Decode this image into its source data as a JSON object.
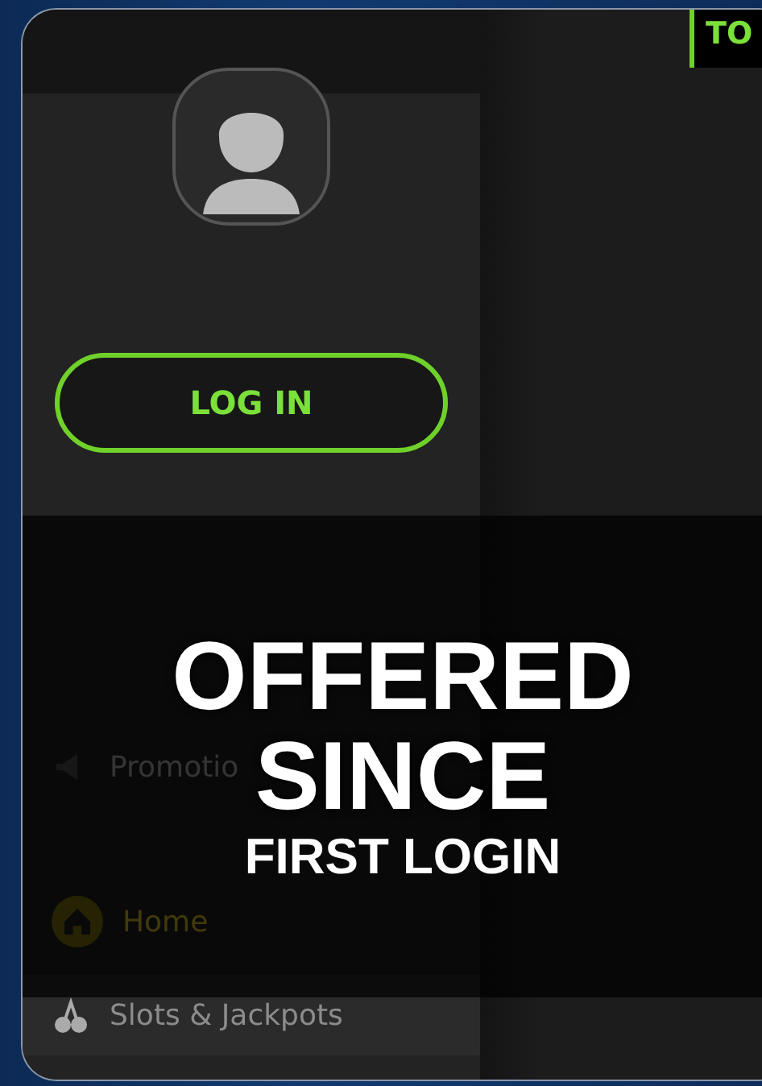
{
  "header_tab": {
    "label": "TO"
  },
  "login_button": {
    "label": "LOG IN"
  },
  "menu": [
    {
      "label": "Promotio",
      "kind": "promotions"
    },
    {
      "label": "Home",
      "kind": "home"
    },
    {
      "label": "Slots & Jackpots",
      "kind": "slots"
    }
  ],
  "banner": {
    "lines": [
      {
        "text": "OFFERED",
        "kind": "headline"
      },
      {
        "text": "SINCE",
        "kind": "headline"
      },
      {
        "text": "FIRST LOGIN",
        "kind": "subline"
      }
    ]
  }
}
